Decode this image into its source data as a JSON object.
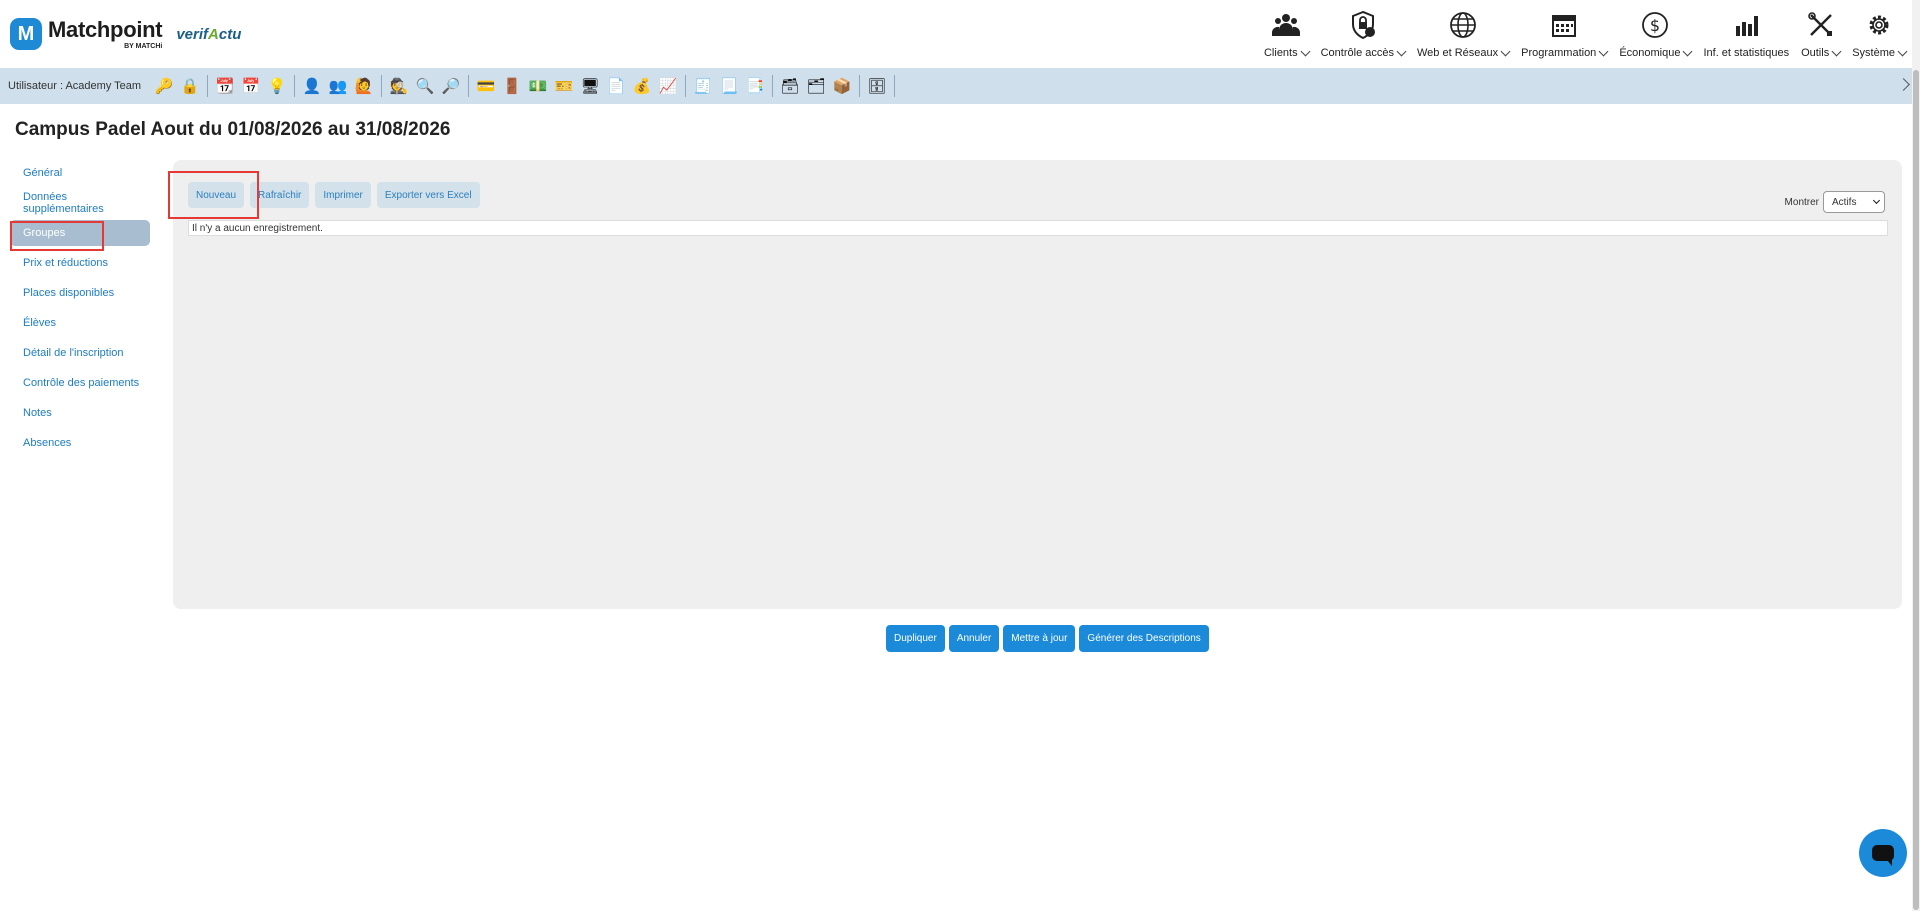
{
  "brand": {
    "name": "Matchpoint",
    "sub": "BY MATCHi",
    "partner": "verifActu"
  },
  "nav": [
    {
      "label": "Clients",
      "icon": "clients-icon"
    },
    {
      "label": "Contrôle accès",
      "icon": "access-control-icon"
    },
    {
      "label": "Web et Réseaux",
      "icon": "globe-icon"
    },
    {
      "label": "Programmation",
      "icon": "calendar-icon"
    },
    {
      "label": "Économique",
      "icon": "dollar-icon"
    },
    {
      "label": "Inf. et statistiques",
      "icon": "bar-chart-icon"
    },
    {
      "label": "Outils",
      "icon": "tools-icon"
    },
    {
      "label": "Système",
      "icon": "gear-icon"
    }
  ],
  "toolbar": {
    "user_label": "Utilisateur :  Academy Team"
  },
  "page": {
    "title": "Campus Padel Aout du 01/08/2026 au 31/08/2026"
  },
  "sidebar": {
    "items": [
      {
        "label": "Général"
      },
      {
        "label": "Données supplémentaires"
      },
      {
        "label": "Groupes",
        "active": true
      },
      {
        "label": "Prix et réductions"
      },
      {
        "label": "Places disponibles"
      },
      {
        "label": "Élèves"
      },
      {
        "label": "Détail de l'inscription"
      },
      {
        "label": "Contrôle des paiements"
      },
      {
        "label": "Notes"
      },
      {
        "label": "Absences"
      }
    ]
  },
  "panel": {
    "buttons": {
      "new": "Nouveau",
      "refresh": "Rafraîchir",
      "print": "Imprimer",
      "export": "Exporter vers Excel"
    },
    "show_label": "Montrer",
    "show_value": "Actifs",
    "empty_text": "Il n'y a aucun enregistrement."
  },
  "actions": {
    "duplicate": "Dupliquer",
    "cancel": "Annuler",
    "update": "Mettre à jour",
    "generate": "Générer des Descriptions"
  },
  "colors": {
    "accent": "#1a8ad9",
    "toolbar_bg": "#cfe0ec",
    "highlight": "#e53935"
  }
}
